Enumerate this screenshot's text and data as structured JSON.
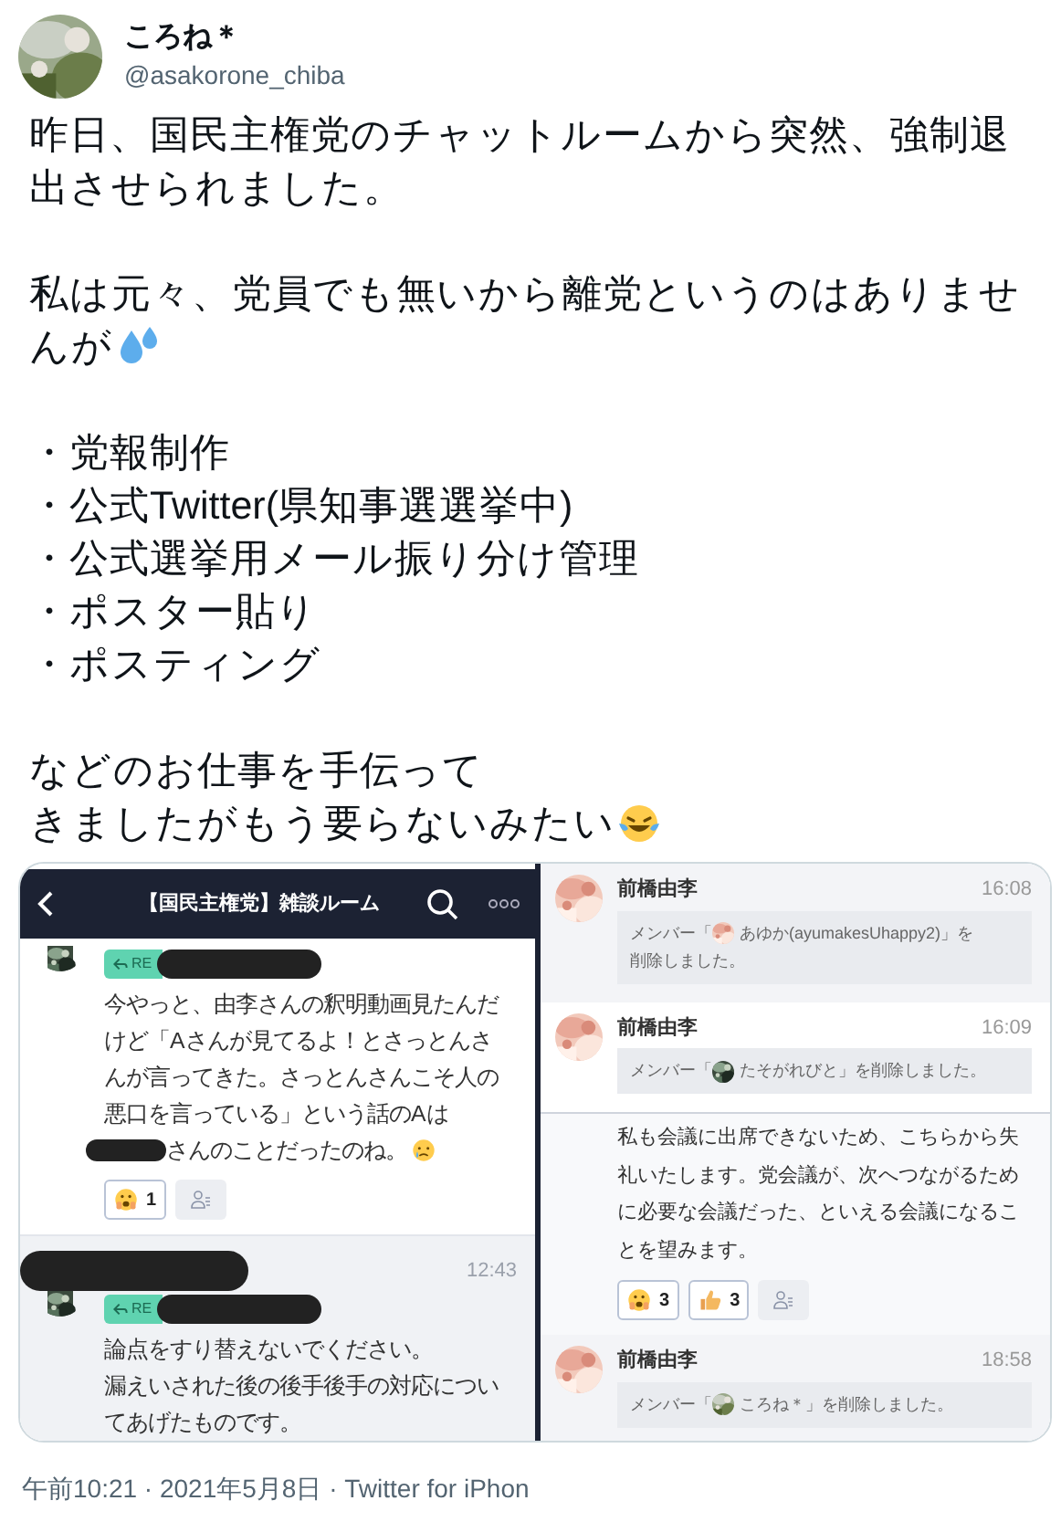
{
  "author": {
    "name": "ころね＊",
    "handle": "@asakorone_chiba"
  },
  "tweet": {
    "blocks": [
      {
        "kind": "paragraph",
        "lines": [
          "昨日、国民主権党のチャットルームから突然、強制退出させられました。"
        ]
      },
      {
        "kind": "paragraph",
        "lines": [
          "私は元々、党員でも無いから離党というのはありませ",
          "んが"
        ],
        "emoji": {
          "kind": "sweat"
        }
      },
      {
        "kind": "list",
        "items": [
          "・党報制作",
          "・公式Twitter(県知事選選挙中)",
          "・公式選挙用メール振り分け管理",
          "・ポスター貼り",
          "・ポスティング"
        ]
      },
      {
        "kind": "paragraph",
        "lines": [
          "などのお仕事を手伝って",
          "きましたがもう要らないみたい"
        ],
        "emoji": {
          "kind": "laugh"
        }
      }
    ]
  },
  "media": {
    "left_screenshot": {
      "header": {
        "title": "【国民主権党】雑談ルーム"
      },
      "messages": [
        {
          "highlighted": false,
          "name_redacted": false,
          "reply": {
            "label": "RE",
            "redacted": true
          },
          "lines": [
            "今やっと、由李さんの釈明動画見たんだけど「Aさんが見てるよ！とさっとんさんが言ってきた。さっとんさんこそ人の悪口を言っている」という話のAは"
          ],
          "tail": {
            "redacted": true,
            "text": "さんのことだったのね。",
            "emoji": {
              "kind": "tear"
            }
          },
          "reactions": [
            {
              "kind": "face",
              "count": "1"
            },
            {
              "kind": "add"
            }
          ]
        },
        {
          "highlighted": true,
          "name_redacted": true,
          "time": "12:43",
          "reply": {
            "label": "RE",
            "redacted": true
          },
          "lines": [
            "論点をすり替えないでください。",
            "漏えいされた後の後手後手の対応についてあげたものです。"
          ]
        }
      ]
    },
    "right_screenshot": {
      "messages": [
        {
          "kind": "notice",
          "highlighted": true,
          "name": "前橋由李",
          "time": "16:08",
          "notice": {
            "before": "メンバー「",
            "after": [
              "あゆか(ayumakesUhappy2)」を",
              "削除しました。"
            ]
          }
        },
        {
          "kind": "notice",
          "highlighted": false,
          "name": "前橋由李",
          "time": "16:09",
          "notice": {
            "before": "メンバー「",
            "after": [
              "たそがれびと」を削除しました。"
            ]
          }
        },
        {
          "kind": "text",
          "lines": [
            "私も会議に出席できないため、こちらから失礼いたします。党会議が、次へつながるために必要な会議だった、といえる会議になることを望みます。"
          ],
          "reactions": [
            {
              "kind": "face",
              "count": "3"
            },
            {
              "kind": "thumbs",
              "count": "3"
            },
            {
              "kind": "add"
            }
          ]
        },
        {
          "kind": "notice",
          "highlighted": true,
          "name": "前橋由李",
          "time": "18:58",
          "notice": {
            "before": "メンバー「",
            "after": [
              "ころね＊」を削除しました。"
            ]
          }
        }
      ]
    }
  },
  "meta": "午前10:21 · 2021年5月8日 · Twitter for iPhon"
}
